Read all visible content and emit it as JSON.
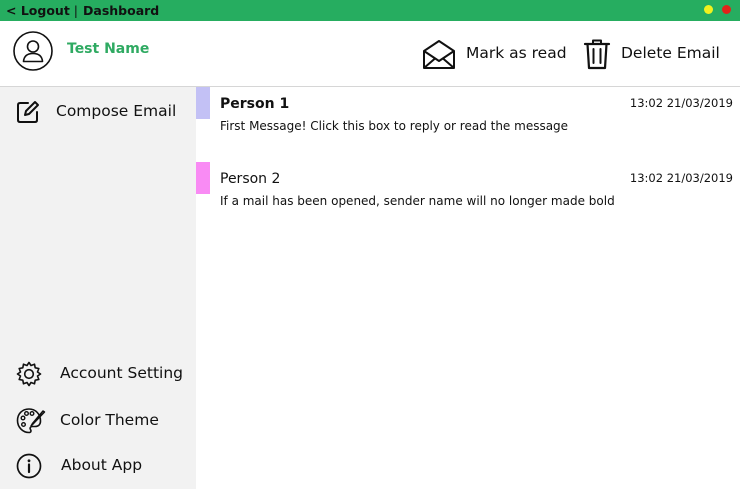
{
  "topbar": {
    "logout_label": "< Logout",
    "separator": "|",
    "dashboard_label": "Dashboard",
    "window_dots": [
      "#f1f11e",
      "#e2231a"
    ]
  },
  "header": {
    "user_name": "Test Name",
    "mark_read_label": "Mark as read",
    "delete_label": "Delete Email"
  },
  "sidebar": {
    "compose_label": "Compose Email",
    "account_setting_label": "Account Setting",
    "color_theme_label": "Color Theme",
    "about_app_label": "About App"
  },
  "emails": [
    {
      "sender": "Person 1",
      "time": "13:02 21/03/2019",
      "preview": "First Message! Click this box to reply or read the message",
      "unread": true,
      "color": "#c3c1f5"
    },
    {
      "sender": "Person 2",
      "time": "13:02 21/03/2019",
      "preview": "If a mail has been opened, sender name will no longer made bold",
      "unread": false,
      "color": "#f98bf4"
    }
  ],
  "colors": {
    "accent": "#26ad60",
    "username": "#2faa62",
    "sidebar_bg": "#f2f2f2"
  }
}
